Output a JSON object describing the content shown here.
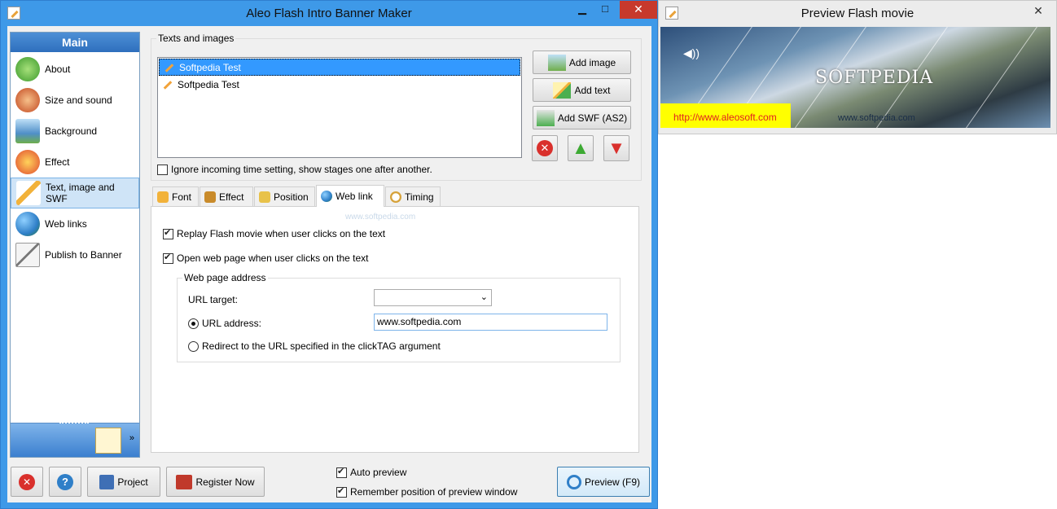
{
  "main_window": {
    "title": "Aleo Flash Intro Banner Maker",
    "minimize": "▁",
    "maximize": "□",
    "close": "✕"
  },
  "nav": {
    "header": "Main",
    "items": [
      {
        "label": "About",
        "icon": "home-icon",
        "color": "#4caf50"
      },
      {
        "label": "Size and sound",
        "icon": "film-reel-icon",
        "color": "#d65c2c"
      },
      {
        "label": "Background",
        "icon": "picture-icon",
        "color": "#5a9bd5"
      },
      {
        "label": "Effect",
        "icon": "magic-effect-icon",
        "color": "#e0492f"
      },
      {
        "label": "Text, image and SWF",
        "icon": "pencil-icon",
        "color": "#f2b23a"
      },
      {
        "label": "Web links",
        "icon": "globe-icon",
        "color": "#2f7fc8"
      },
      {
        "label": "Publish to Banner",
        "icon": "publish-icon",
        "color": "#8c8c8c"
      }
    ],
    "foot_chevron": "»"
  },
  "texts_group": {
    "title": "Texts and images",
    "items": [
      "Softpedia Test",
      "Softpedia Test"
    ],
    "ignore_label": "Ignore incoming time setting, show stages one after another.",
    "add_image": "Add image",
    "add_text": "Add text",
    "add_swf": "Add SWF (AS2)"
  },
  "tabs": [
    {
      "label": "Font",
      "color": "#f2b23a"
    },
    {
      "label": "Effect",
      "color": "#c98b2b"
    },
    {
      "label": "Position",
      "color": "#e8c24a"
    },
    {
      "label": "Web link",
      "color": "#2f7fc8"
    },
    {
      "label": "Timing",
      "color": "#d6a23a"
    }
  ],
  "web_link": {
    "watermark": "www.softpedia.com",
    "replay_label": "Replay Flash movie when user clicks on the text",
    "open_label": "Open web page when user clicks on the text",
    "group_title": "Web page address",
    "url_target_label": "URL target:",
    "url_target_value": "",
    "url_address_label": "URL address:",
    "url_address_value": "www.softpedia.com",
    "redirect_label": "Redirect to the URL specified in the clickTAG argument"
  },
  "bottom": {
    "project": "Project",
    "register": "Register Now",
    "auto_preview": "Auto preview",
    "remember_position": "Remember position of preview window",
    "preview": "Preview (F9)"
  },
  "preview_window": {
    "title": "Preview Flash movie",
    "close": "✕",
    "banner_brand": "SOFTPEDIA",
    "banner_url": "http://www.aleosoft.com",
    "banner_small_url": "www.softpedia.com"
  }
}
